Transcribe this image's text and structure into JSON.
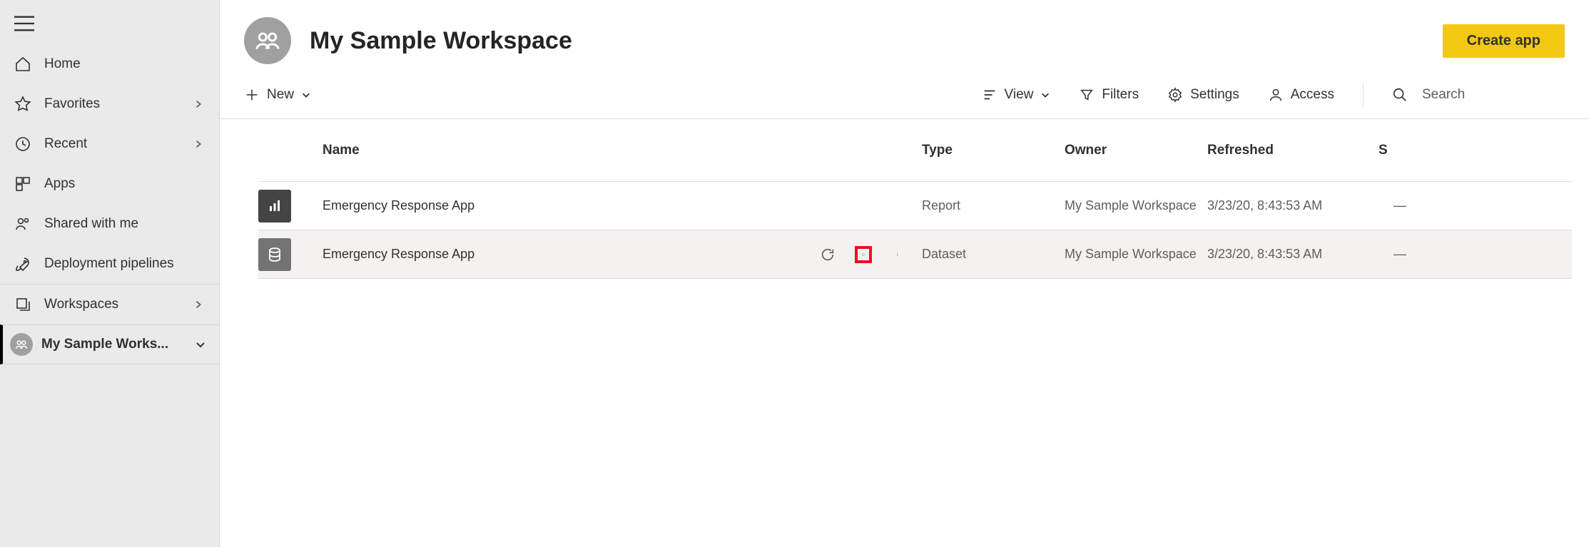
{
  "sidebar": {
    "items": [
      {
        "label": "Home"
      },
      {
        "label": "Favorites"
      },
      {
        "label": "Recent"
      },
      {
        "label": "Apps"
      },
      {
        "label": "Shared with me"
      },
      {
        "label": "Deployment pipelines"
      }
    ],
    "workspaces_label": "Workspaces",
    "current_workspace": "My Sample Works..."
  },
  "header": {
    "title": "My Sample Workspace",
    "create_app_label": "Create app"
  },
  "toolbar": {
    "new_label": "New",
    "view_label": "View",
    "filters_label": "Filters",
    "settings_label": "Settings",
    "access_label": "Access",
    "search_placeholder": "Search"
  },
  "table": {
    "columns": {
      "name": "Name",
      "type": "Type",
      "owner": "Owner",
      "refreshed": "Refreshed",
      "sensitivity": "S"
    },
    "rows": [
      {
        "name": "Emergency Response App",
        "type": "Report",
        "owner": "My Sample Workspace",
        "refreshed": "3/23/20, 8:43:53 AM",
        "sensitivity": "—"
      },
      {
        "name": "Emergency Response App",
        "type": "Dataset",
        "owner": "My Sample Workspace",
        "refreshed": "3/23/20, 8:43:53 AM",
        "sensitivity": "—"
      }
    ]
  }
}
